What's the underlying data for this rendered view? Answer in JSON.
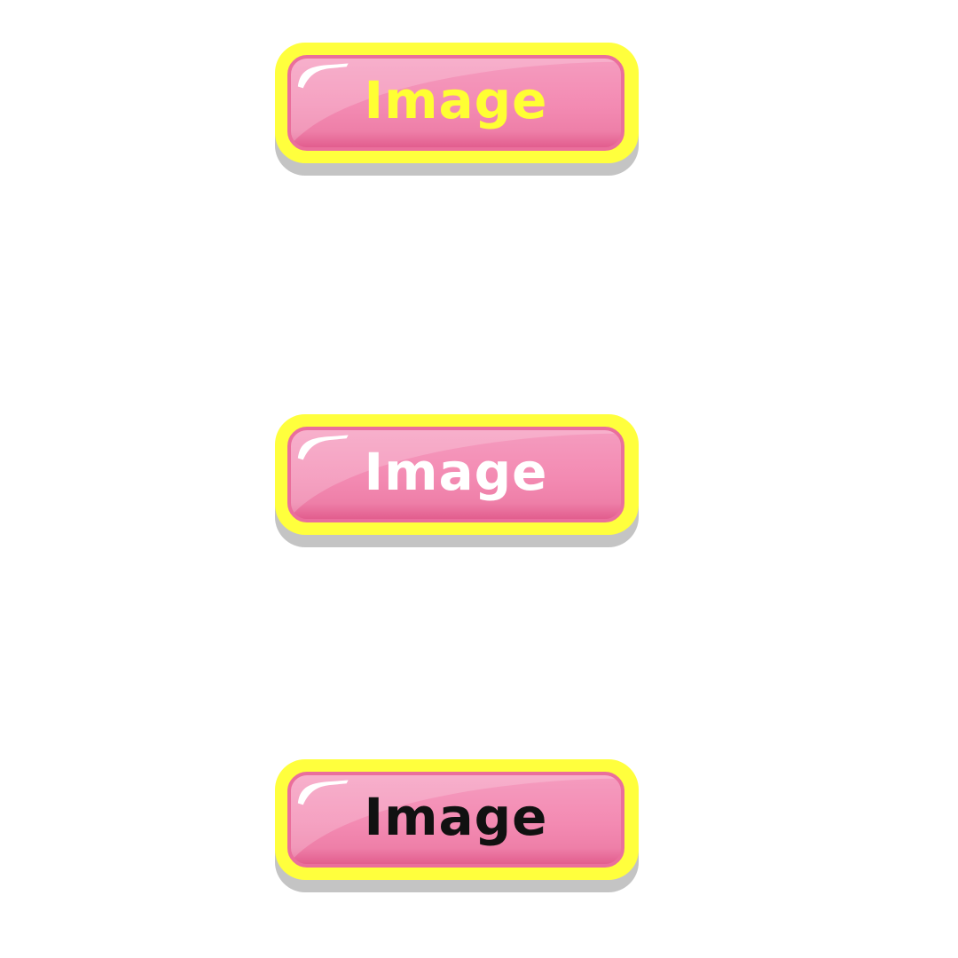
{
  "buttons": [
    {
      "label": "Image",
      "text_color": "#ffff33"
    },
    {
      "label": "Image",
      "text_color": "#ffffff"
    },
    {
      "label": "Image",
      "text_color": "#111111"
    }
  ],
  "colors": {
    "frame": "#ffff3d",
    "face": "#f38ab2",
    "face_border": "#ea6f9c",
    "shadow": "#c4c4c4",
    "background": "#ffffff"
  }
}
